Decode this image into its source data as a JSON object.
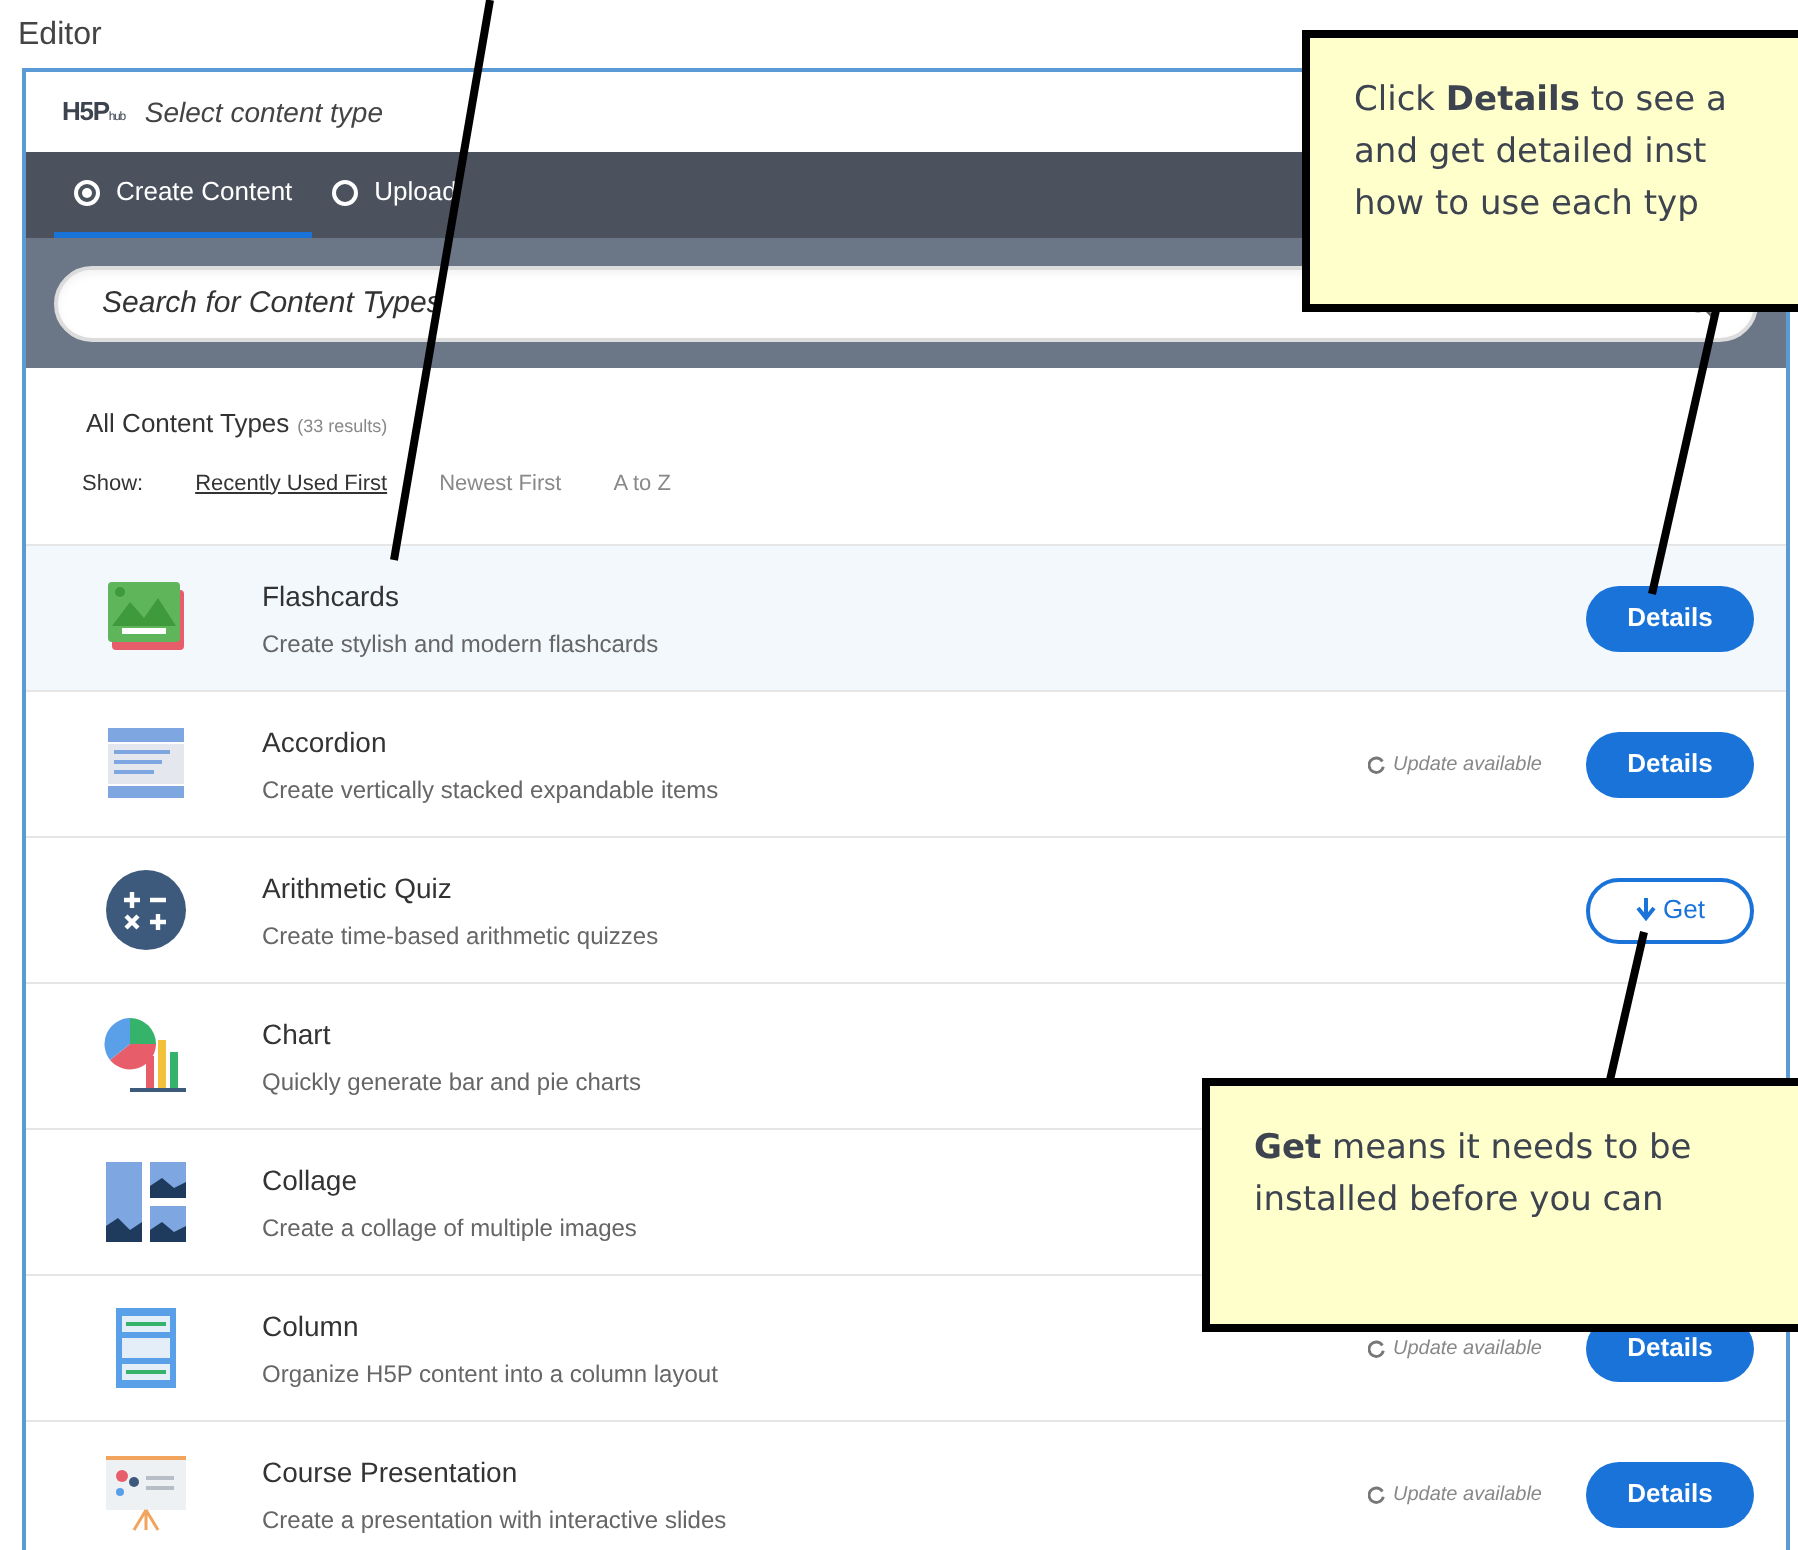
{
  "editor_label": "Editor",
  "hub": {
    "logo": "H5P",
    "logo_sub": "hub",
    "title": "Select content type"
  },
  "tabs": [
    {
      "label": "Create Content",
      "selected": true
    },
    {
      "label": "Upload",
      "selected": false
    }
  ],
  "search": {
    "placeholder": "Search for Content Types"
  },
  "results": {
    "heading": "All Content Types",
    "count": "(33 results)"
  },
  "sort": {
    "label": "Show:",
    "options": [
      {
        "label": "Recently Used First",
        "selected": true
      },
      {
        "label": "Newest First",
        "selected": false
      },
      {
        "label": "A to Z",
        "selected": false
      }
    ]
  },
  "items": [
    {
      "kind": "flashcards",
      "title": "Flashcards",
      "description": "Create stylish and modern flashcards",
      "selected": true,
      "action": {
        "kind": "details",
        "label": "Details"
      }
    },
    {
      "kind": "accordion",
      "title": "Accordion",
      "description": "Create vertically stacked expandable items",
      "selected": false,
      "update": "Update available",
      "action": {
        "kind": "details",
        "label": "Details"
      }
    },
    {
      "kind": "arithmetic",
      "title": "Arithmetic Quiz",
      "description": "Create time-based arithmetic quizzes",
      "selected": false,
      "action": {
        "kind": "get",
        "label": "Get"
      }
    },
    {
      "kind": "chart",
      "title": "Chart",
      "description": "Quickly generate bar and pie charts",
      "selected": false
    },
    {
      "kind": "collage",
      "title": "Collage",
      "description": "Create a collage of multiple images",
      "selected": false
    },
    {
      "kind": "column",
      "title": "Column",
      "description": "Organize H5P content into a column layout",
      "selected": false,
      "update": "Update available",
      "action": {
        "kind": "details",
        "label": "Details"
      }
    },
    {
      "kind": "presentation",
      "title": "Course Presentation",
      "description": "Create a presentation with interactive slides",
      "selected": false,
      "update": "Update available",
      "action": {
        "kind": "details",
        "label": "Details"
      }
    }
  ],
  "callouts": [
    {
      "lines": [
        "Click **Details**  to see a",
        "and get detailed inst",
        "how to use each typ"
      ]
    },
    {
      "lines": [
        "**Get**  means it needs to be",
        "installed before you can"
      ]
    }
  ]
}
